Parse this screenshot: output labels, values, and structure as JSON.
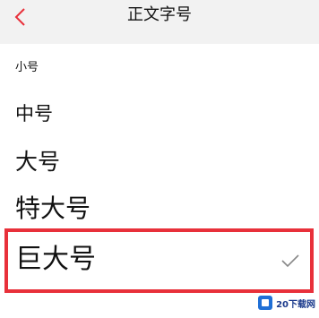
{
  "header": {
    "title": "正文字号",
    "back_icon": "chevron-left-icon",
    "accent_color": "#e8303a"
  },
  "options": [
    {
      "label": "小号",
      "selected": false
    },
    {
      "label": "中号",
      "selected": false
    },
    {
      "label": "大号",
      "selected": false
    },
    {
      "label": "特大号",
      "selected": false
    },
    {
      "label": "巨大号",
      "selected": true
    }
  ],
  "check_icon": "checkmark-icon",
  "highlight_color": "#e8303a",
  "watermark": {
    "text": "20下载网"
  }
}
